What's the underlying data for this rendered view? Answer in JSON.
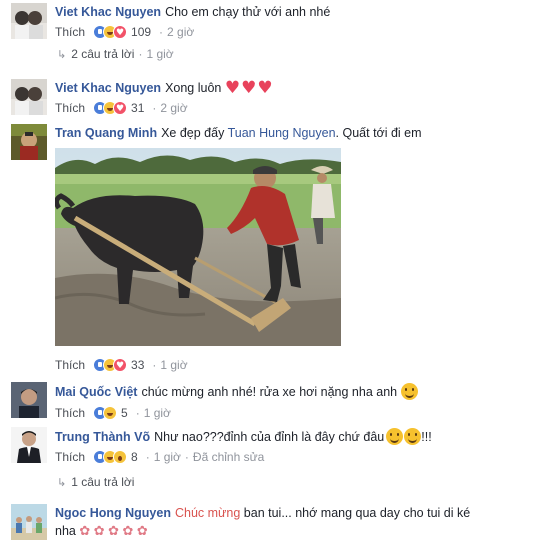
{
  "comments": [
    {
      "author": "Viet Khac Nguyen",
      "text": "Cho em chạy thử với anh nhé",
      "like_label": "Thích",
      "reaction_count": "109",
      "time": "2 giờ",
      "reply_count_label": "2 câu trả lời",
      "reply_time": "1 giờ"
    },
    {
      "author": "Viet Khac Nguyen",
      "text": "Xong luôn",
      "like_label": "Thích",
      "reaction_count": "31",
      "time": "2 giờ"
    },
    {
      "author": "Tran Quang Minh",
      "text_before": "Xe đẹp đấy ",
      "mention": "Tuan Hung Nguyen",
      "text_after": ". Quất tới đi em",
      "like_label": "Thích",
      "reaction_count": "33",
      "time": "1 giờ"
    },
    {
      "author": "Mai Quốc Việt",
      "text": "chúc mừng anh nhé! rửa xe hơi nặng nha anh",
      "like_label": "Thích",
      "reaction_count": "5",
      "time": "1 giờ"
    },
    {
      "author": "Trung Thành Võ",
      "text_before": "Như nao???đỉnh của đỉnh là đây chứ đâu",
      "text_after": "!!!",
      "like_label": "Thích",
      "reaction_count": "8",
      "time": "1 giờ",
      "edited": "Đã chỉnh sửa",
      "reply_count_label": "1 câu trả lời"
    },
    {
      "author": "Ngoc Hong Nguyen",
      "mention": "Chúc mừng",
      "text_after": " ban tui... nhớ mang qua day cho tui di ké",
      "text_line2": "nha"
    }
  ],
  "icons": {
    "like_reaction": "like-icon",
    "haha_reaction": "haha-icon",
    "love_reaction": "love-icon",
    "reply_arrow": "reply-arrow-icon",
    "heart_emoji": "heart-icon",
    "smile_emoji": "smile-icon",
    "flower_emoji": "flower-icon"
  },
  "colors": {
    "author_link": "#365899",
    "meta_text": "#90949c",
    "like_blue": "#4a7dd9",
    "heart_red": "#e8425b"
  }
}
